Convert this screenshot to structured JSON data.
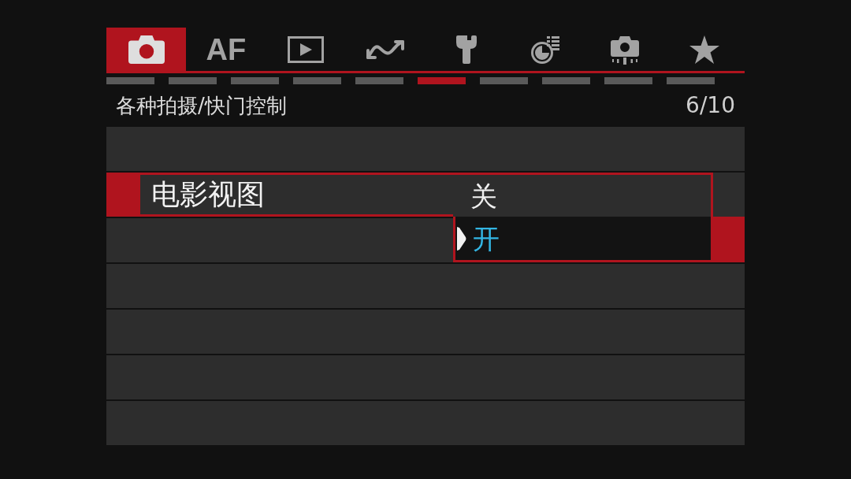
{
  "tabs": [
    {
      "kind": "icon",
      "selected": true
    },
    {
      "kind": "text",
      "label": "AF",
      "selected": false
    },
    {
      "kind": "icon",
      "selected": false
    },
    {
      "kind": "icon",
      "selected": false
    },
    {
      "kind": "icon",
      "selected": false
    },
    {
      "kind": "icon",
      "selected": false
    },
    {
      "kind": "icon",
      "selected": false
    },
    {
      "kind": "icon",
      "selected": false
    }
  ],
  "pages": [
    {
      "selected": false
    },
    {
      "selected": false
    },
    {
      "selected": false
    },
    {
      "selected": false
    },
    {
      "selected": false
    },
    {
      "selected": true
    },
    {
      "selected": false
    },
    {
      "selected": false
    },
    {
      "selected": false
    },
    {
      "selected": false
    }
  ],
  "header": {
    "title": "各种拍摄/快门控制",
    "page": "6/10"
  },
  "menu": {
    "items": [
      {
        "kind": "blank"
      },
      {
        "kind": "setting",
        "label": "电影视图",
        "selected": true,
        "expanded": true,
        "options": [
          {
            "label": "关",
            "selected": false
          },
          {
            "label": "开",
            "selected": true
          }
        ]
      },
      {
        "kind": "blank"
      },
      {
        "kind": "blank"
      },
      {
        "kind": "blank"
      },
      {
        "kind": "blank"
      },
      {
        "kind": "blank"
      }
    ]
  }
}
